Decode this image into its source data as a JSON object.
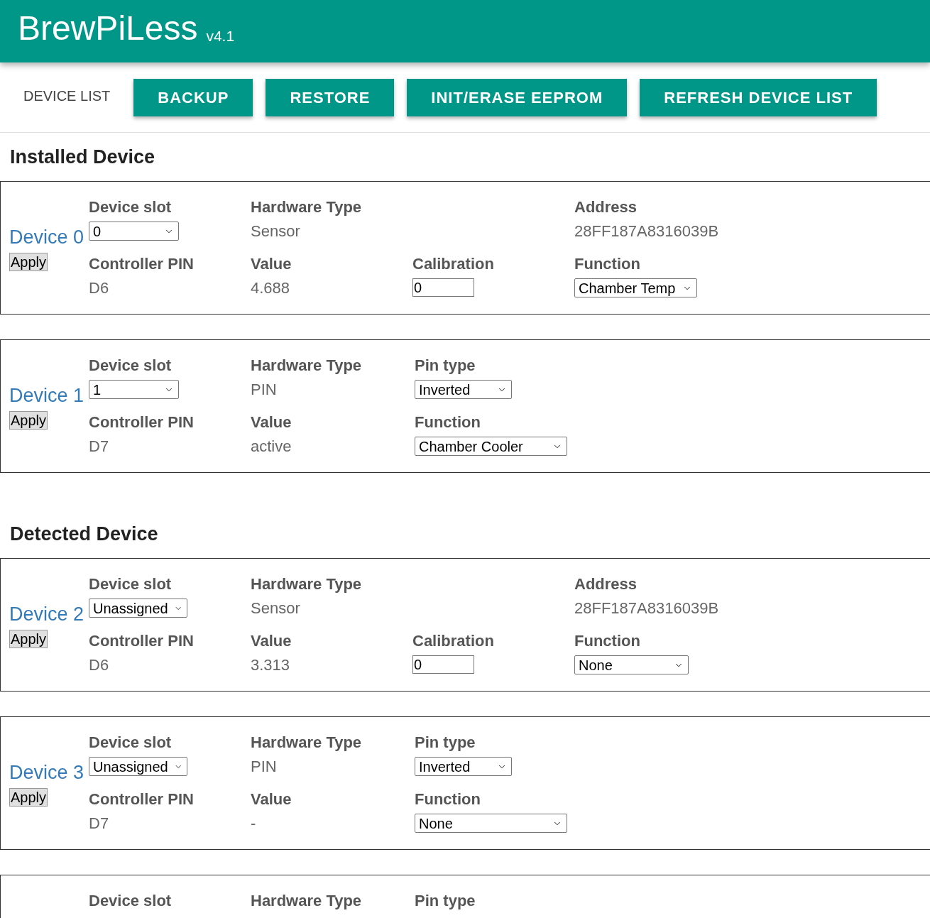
{
  "header": {
    "title": "BrewPiLess",
    "version": "v4.1"
  },
  "toolbar": {
    "label": "DEVICE LIST",
    "buttons": [
      "BACKUP",
      "RESTORE",
      "INIT/ERASE EEPROM",
      "REFRESH DEVICE LIST"
    ]
  },
  "sections": [
    {
      "title": "Installed Device",
      "devices": [
        {
          "kind": "sensor",
          "name": "Device 0",
          "apply": "Apply",
          "slot_label": "Device slot",
          "slot": "0",
          "hw_label": "Hardware Type",
          "hardware_type": "Sensor",
          "address_label": "Address",
          "address": "28FF187A8316039B",
          "pin_label": "Controller PIN",
          "pin": "D6",
          "value_label": "Value",
          "value": "4.688",
          "calibration_label": "Calibration",
          "calibration": "0",
          "function_label": "Function",
          "function": "Chamber Temp"
        },
        {
          "kind": "pin",
          "name": "Device 1",
          "apply": "Apply",
          "slot_label": "Device slot",
          "slot": "1",
          "hw_label": "Hardware Type",
          "hardware_type": "PIN",
          "pin_type_label": "Pin type",
          "pin_type": "Inverted",
          "pin_label": "Controller PIN",
          "pin": "D7",
          "value_label": "Value",
          "value": "active",
          "function_label": "Function",
          "function": "Chamber Cooler"
        }
      ]
    },
    {
      "title": "Detected Device",
      "devices": [
        {
          "kind": "sensor",
          "name": "Device 2",
          "apply": "Apply",
          "slot_label": "Device slot",
          "slot": "Unassigned",
          "hw_label": "Hardware Type",
          "hardware_type": "Sensor",
          "address_label": "Address",
          "address": "28FF187A8316039B",
          "pin_label": "Controller PIN",
          "pin": "D6",
          "value_label": "Value",
          "value": "3.313",
          "calibration_label": "Calibration",
          "calibration": "0",
          "function_label": "Function",
          "function": "None"
        },
        {
          "kind": "pin",
          "name": "Device 3",
          "apply": "Apply",
          "slot_label": "Device slot",
          "slot": "Unassigned",
          "hw_label": "Hardware Type",
          "hardware_type": "PIN",
          "pin_type_label": "Pin type",
          "pin_type": "Inverted",
          "pin_label": "Controller PIN",
          "pin": "D7",
          "value_label": "Value",
          "value": "-",
          "function_label": "Function",
          "function": "None"
        },
        {
          "kind": "partial",
          "slot_label": "Device slot",
          "hw_label": "Hardware Type",
          "pin_type_label": "Pin type"
        }
      ]
    }
  ]
}
